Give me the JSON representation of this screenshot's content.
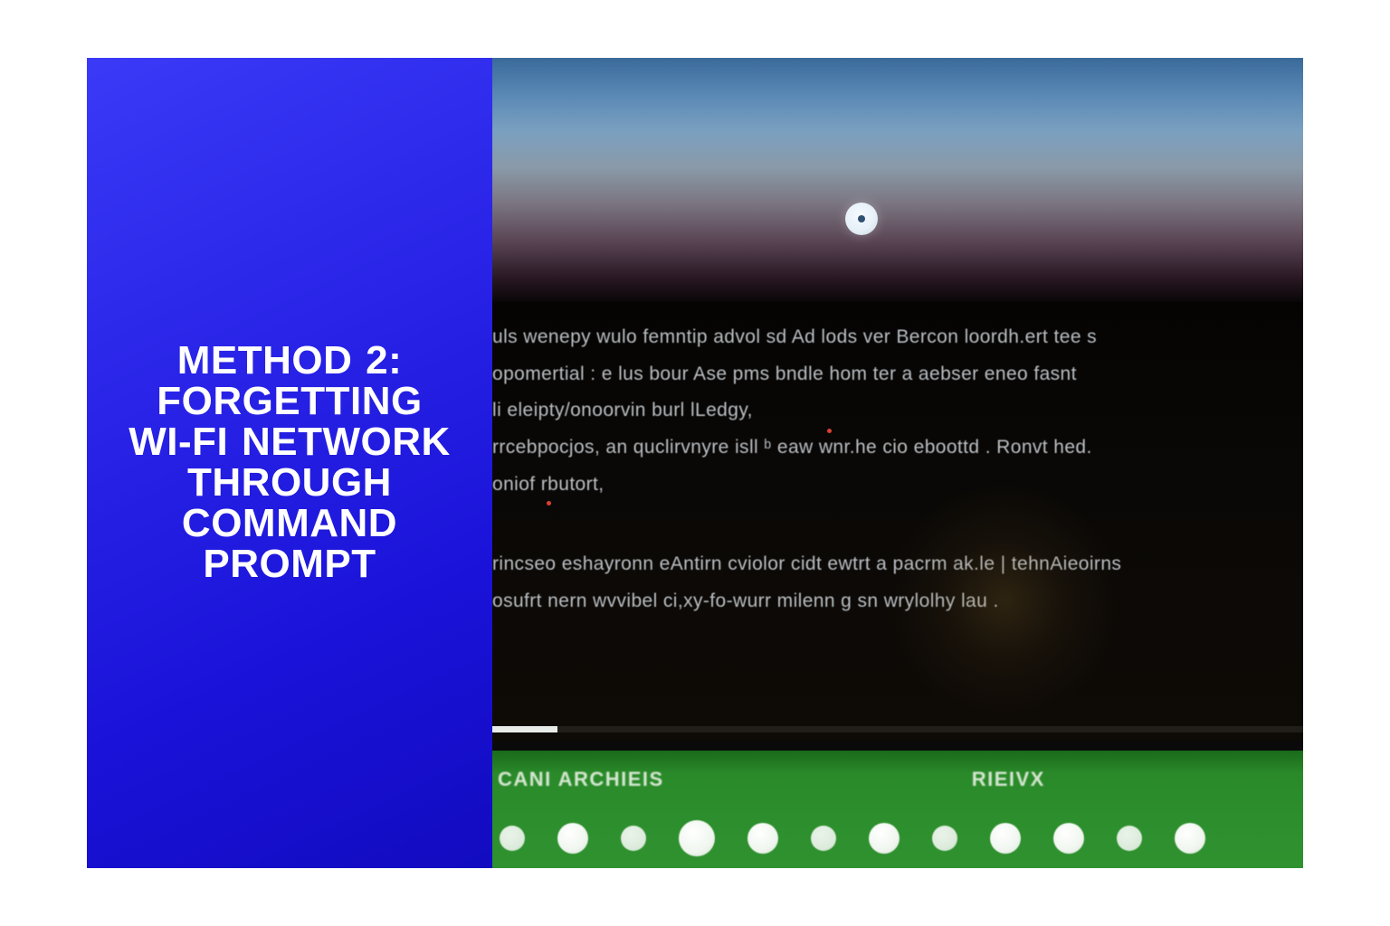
{
  "left": {
    "title_html": "METHOD 2:<br>FORGETTING<br>WI-FI NETWORK<br>THROUGH<br>COMMAND<br>PROMPT"
  },
  "screen": {
    "lines": [
      "uls wenepy wulo femntip  advol sd Ad lods ver Bercon loordh.ert  tee s",
      "opomertial :  e lus bour   Ase pms bndle hom ter a  aebser eneo fasnt",
      "li eleipty/onoorvin burl lLedgy,",
      "rrcebpocjos, an quclirvnyre isll ᵇ   eaw wnr.he cio eboottd . Ronvt hed.",
      "oniof  rbutort,",
      "",
      "rincseo eshayronn eAntirn cviolor cidt ewtrt a pacrm ak.le | tehnAieoirns",
      "osufrt nern wvvibel ci,xy-fo-wurr milenn g sn wrylolhy lau ."
    ],
    "bottom_left_label": "CANI  ARCHIEIS",
    "bottom_right_label": "RIEIVX"
  }
}
